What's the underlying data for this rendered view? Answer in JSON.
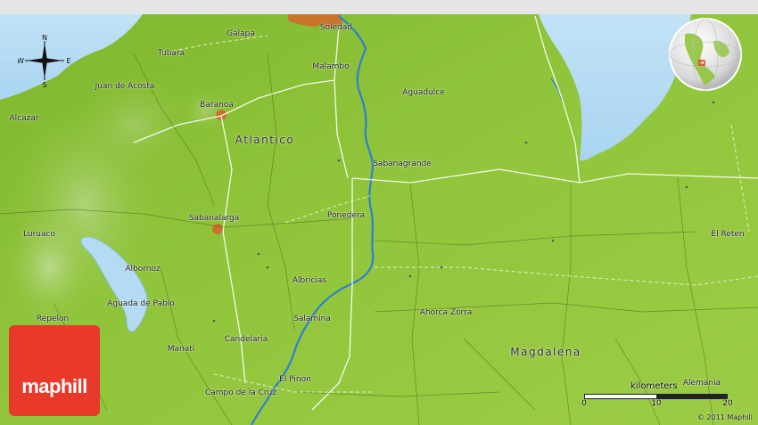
{
  "places": [
    {
      "id": "soledad",
      "name": "Soledad"
    },
    {
      "id": "galapa",
      "name": "Galapa"
    },
    {
      "id": "tubara",
      "name": "Tubara"
    },
    {
      "id": "malambo",
      "name": "Malambo"
    },
    {
      "id": "juan-de-acosta",
      "name": "Juan de Acosta"
    },
    {
      "id": "aguadulce",
      "name": "Aguadulce"
    },
    {
      "id": "baranoa",
      "name": "Baranoa"
    },
    {
      "id": "alcazar",
      "name": "Alcazar"
    },
    {
      "id": "sabanagrande",
      "name": "Sabanagrande"
    },
    {
      "id": "sabanalarga",
      "name": "Sabanalarga"
    },
    {
      "id": "ponedera",
      "name": "Ponedera"
    },
    {
      "id": "luruaco",
      "name": "Luruaco"
    },
    {
      "id": "el-reten",
      "name": "El Reten"
    },
    {
      "id": "albornoz",
      "name": "Albornoz"
    },
    {
      "id": "albricias",
      "name": "Albricias"
    },
    {
      "id": "aguada-de-pablo",
      "name": "Aguada de Pablo"
    },
    {
      "id": "ahorca-zorra",
      "name": "Ahorca Zorra"
    },
    {
      "id": "repelon",
      "name": "Repelon"
    },
    {
      "id": "salamina",
      "name": "Salamina"
    },
    {
      "id": "candelaria",
      "name": "Candelaria"
    },
    {
      "id": "manati",
      "name": "Manati"
    },
    {
      "id": "el-pinon",
      "name": "El Pinon"
    },
    {
      "id": "alemania",
      "name": "Alemania"
    },
    {
      "id": "campo-de-la-cruz",
      "name": "Campo de la Cruz"
    }
  ],
  "regions": [
    {
      "id": "atlantico",
      "name": "Atlantico"
    },
    {
      "id": "magdalena",
      "name": "Magdalena"
    }
  ],
  "compass": {
    "n": "N",
    "s": "S",
    "w": "W",
    "e": "E"
  },
  "scale": {
    "title": "kilometers",
    "ticks": [
      "0",
      "10",
      "20"
    ]
  },
  "logo": {
    "text": "maphill"
  },
  "copyright": "© 2011 Maphill",
  "colors": {
    "land": "#8fc43a",
    "water": "#a8d3f0",
    "river": "#2f7fd0",
    "urban": "#c8742a",
    "logo": "#e8392b",
    "road": "#ffffff"
  }
}
